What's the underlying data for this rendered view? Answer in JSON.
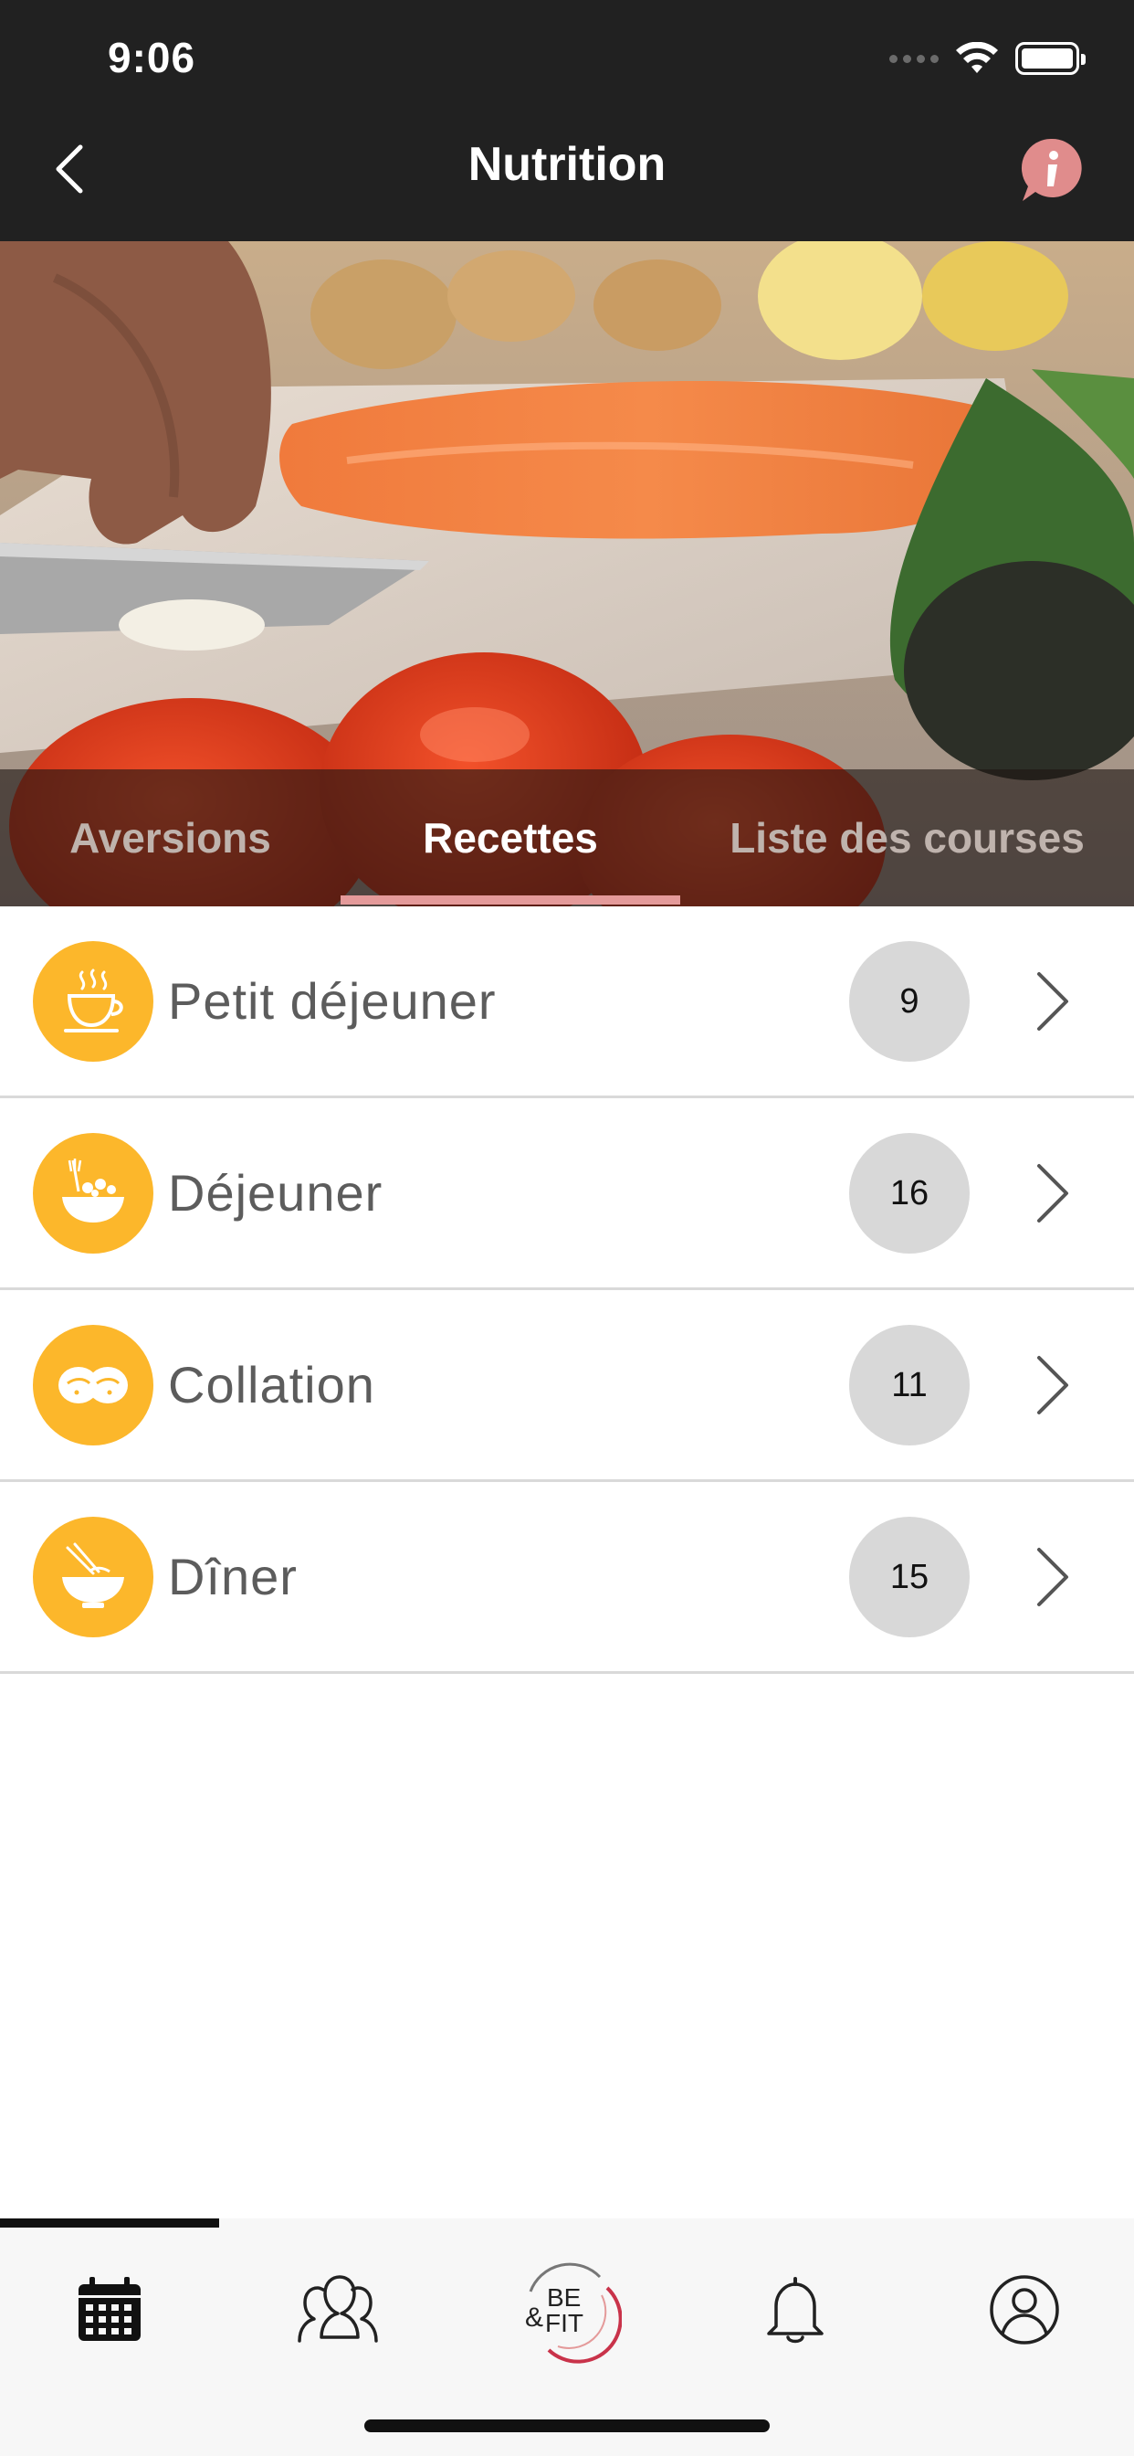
{
  "status_bar": {
    "time": "9:06"
  },
  "nav": {
    "title": "Nutrition"
  },
  "tabs": [
    {
      "label": "Aversions",
      "active": false
    },
    {
      "label": "Recettes",
      "active": true
    },
    {
      "label": "Liste des courses",
      "active": false
    }
  ],
  "meals": [
    {
      "label": "Petit déjeuner",
      "count": "9",
      "icon": "coffee-cup-icon"
    },
    {
      "label": "Déjeuner",
      "count": "16",
      "icon": "salad-bowl-icon"
    },
    {
      "label": "Collation",
      "count": "11",
      "icon": "cookies-icon"
    },
    {
      "label": "Dîner",
      "count": "15",
      "icon": "noodle-bowl-icon"
    }
  ],
  "tab_bar": {
    "items": [
      "calendar-icon",
      "community-icon",
      "be-and-fit-logo",
      "bell-icon",
      "profile-icon"
    ],
    "logo_text": {
      "line1": "BE",
      "amp": "&",
      "line2": "FIT"
    }
  },
  "colors": {
    "header": "#212121",
    "accent_yellow": "#fcb72b",
    "accent_pink": "#e49a9a",
    "count_bg": "#d8d8d8"
  }
}
